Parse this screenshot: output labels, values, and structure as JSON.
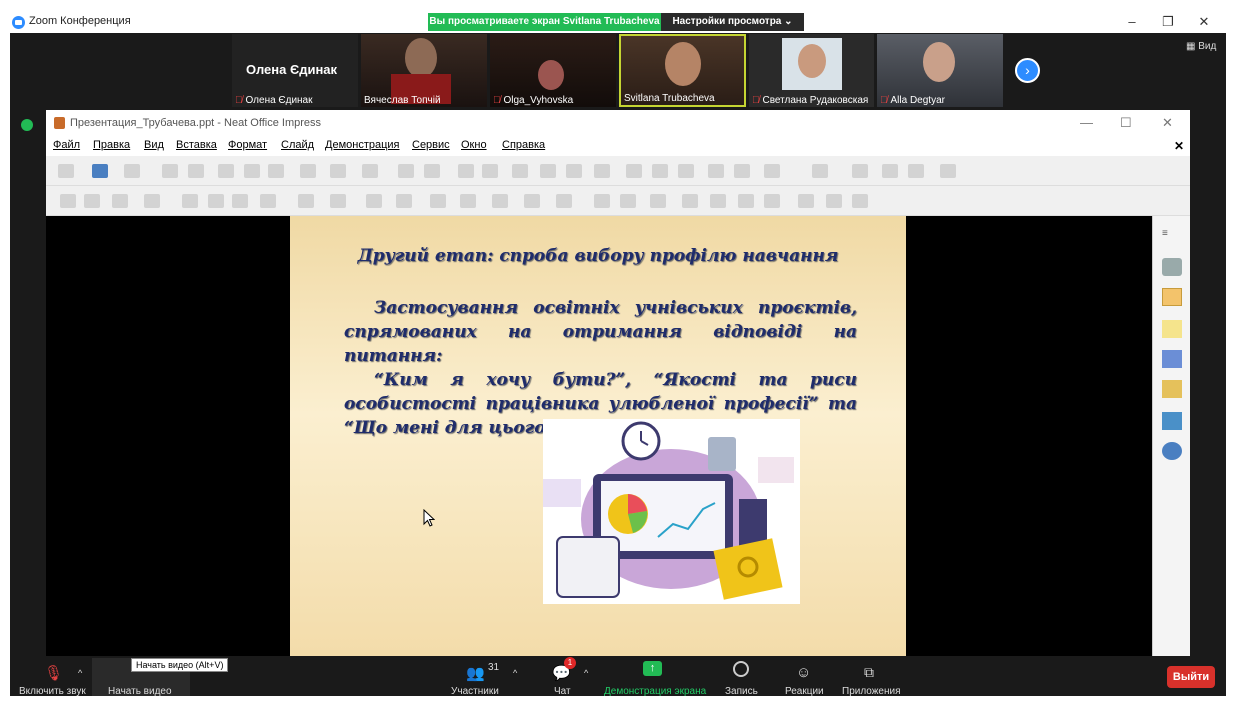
{
  "zoom": {
    "window_title": "Zoom Конференция",
    "share_banner": "Вы просматриваете экран Svitlana Trubacheva",
    "view_options": "Настройки просмотра ⌄",
    "view_label": "Вид"
  },
  "participants": [
    {
      "name": "Олена Єдинак",
      "muted": true,
      "big_name": "Олена Єдинак"
    },
    {
      "name": "Вячеслав Топчій",
      "muted": false
    },
    {
      "name": "Olga_Vyhovska",
      "muted": true
    },
    {
      "name": "Svitlana Trubacheva",
      "muted": false
    },
    {
      "name": "Светлана Рудаковская",
      "muted": true
    },
    {
      "name": "Alla Degtyar",
      "muted": true
    }
  ],
  "impress": {
    "title": "Презентация_Трубачева.ppt - Neat Office Impress",
    "menu": [
      "Файл",
      "Правка",
      "Вид",
      "Вставка",
      "Формат",
      "Слайд",
      "Демонстрация",
      "Сервис",
      "Окно",
      "Справка"
    ]
  },
  "slide": {
    "title": "Другий етап: спроба вибору профілю навчання",
    "para1": "Застосування освітніх учнівських проєктів, спрямованих на отримання відповіді на питання:",
    "para2": "“Ким я хочу бути?”, “Якості та риси особистості працівника улюбленої професії” та “Що мені для цього потрібно вивчати?”"
  },
  "bottom": {
    "mute_label": "Включить звук",
    "video_label": "Начать видео",
    "tooltip": "Начать видео (Alt+V)",
    "participants_label": "Участники",
    "participants_count": "31",
    "chat_label": "Чат",
    "chat_badge": "1",
    "share_label": "Демонстрация экрана",
    "record_label": "Запись",
    "reactions_label": "Реакции",
    "apps_label": "Приложения",
    "leave_label": "Выйти"
  },
  "colors": {
    "share_green": "#22bb55",
    "zoom_blue": "#2d8cff",
    "leave_red": "#d8312b",
    "slide_text": "#1f2c6b"
  }
}
